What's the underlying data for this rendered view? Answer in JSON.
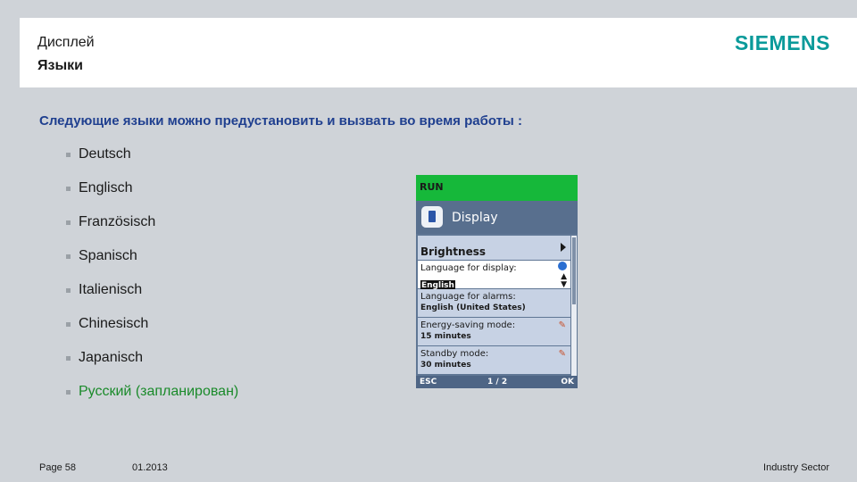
{
  "header": {
    "title_line1": "Дисплей",
    "title_line2": "Языки",
    "logo": "SIEMENS"
  },
  "intro": "Следующие языки можно предустановить и вызвать во время работы :",
  "languages": [
    "Deutsch",
    "Englisch",
    "Französisch",
    "Spanisch",
    "Italienisch",
    "Chinesisch",
    "Japanisch",
    "Русский (запланирован)"
  ],
  "device": {
    "status": "RUN",
    "screen_title": "Display",
    "menu": [
      {
        "label": "Brightness"
      },
      {
        "label": "Language for display:",
        "value": "English"
      },
      {
        "label": "Language for alarms:",
        "value": "English (United States)"
      },
      {
        "label": "Energy-saving mode:",
        "value": "15 minutes"
      },
      {
        "label": "Standby mode:",
        "value": "30 minutes"
      }
    ],
    "footer": {
      "left": "ESC",
      "center": "1 / 2",
      "right": "OK"
    }
  },
  "footer": {
    "page": "Page 58",
    "date": "01.2013",
    "sector": "Industry Sector"
  },
  "colors": {
    "accent_blue": "#1f3f8f",
    "siemens_teal": "#0a9a9a",
    "planned_green": "#1a8a2a",
    "run_green": "#16b83a"
  }
}
